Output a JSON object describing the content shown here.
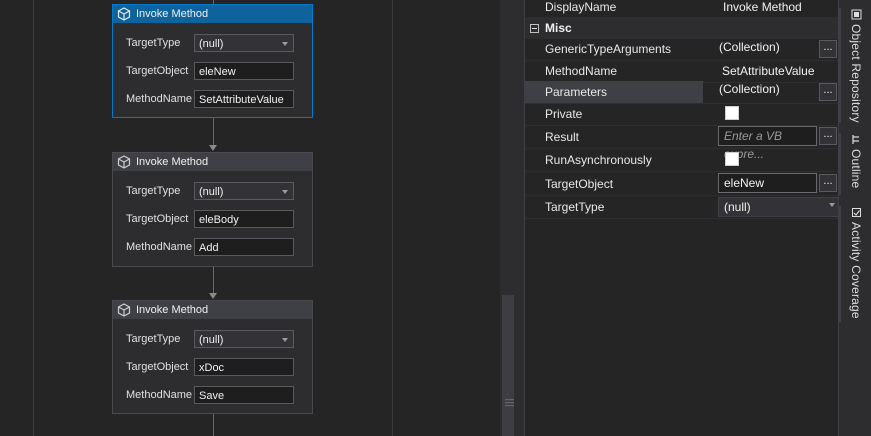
{
  "designer": {
    "activities": [
      {
        "title": "Invoke Method",
        "selected": true,
        "fields": [
          {
            "label": "TargetType",
            "value": "(null)",
            "kind": "select"
          },
          {
            "label": "TargetObject",
            "value": "eleNew",
            "kind": "text"
          },
          {
            "label": "MethodName",
            "value": "SetAttributeValue",
            "kind": "text"
          }
        ]
      },
      {
        "title": "Invoke Method",
        "selected": false,
        "fields": [
          {
            "label": "TargetType",
            "value": "(null)",
            "kind": "select"
          },
          {
            "label": "TargetObject",
            "value": "eleBody",
            "kind": "text"
          },
          {
            "label": "MethodName",
            "value": "Add",
            "kind": "text"
          }
        ]
      },
      {
        "title": "Invoke Method",
        "selected": false,
        "fields": [
          {
            "label": "TargetType",
            "value": "(null)",
            "kind": "select"
          },
          {
            "label": "TargetObject",
            "value": "xDoc",
            "kind": "text"
          },
          {
            "label": "MethodName",
            "value": "Save",
            "kind": "text"
          }
        ]
      }
    ]
  },
  "properties": {
    "top_row": {
      "name": "DisplayName",
      "value": "Invoke Method"
    },
    "category": "Misc",
    "rows": [
      {
        "name": "GenericTypeArguments",
        "value": "(Collection)",
        "kind": "collection"
      },
      {
        "name": "MethodName",
        "value": "SetAttributeValue",
        "kind": "text"
      },
      {
        "name": "Parameters",
        "value": "(Collection)",
        "kind": "collection"
      },
      {
        "name": "Private",
        "value": "",
        "kind": "checkbox"
      },
      {
        "name": "Result",
        "value": "Enter a VB expre...",
        "kind": "placeholder"
      },
      {
        "name": "RunAsynchronously",
        "value": "",
        "kind": "checkbox"
      },
      {
        "name": "TargetObject",
        "value": "eleNew",
        "kind": "boxed"
      },
      {
        "name": "TargetType",
        "value": "(null)",
        "kind": "select"
      }
    ],
    "ellipsis_label": "..."
  },
  "side_tabs": [
    {
      "label": "Object Repository",
      "icon": "object-repository-icon"
    },
    {
      "label": "Outline",
      "icon": "outline-icon"
    },
    {
      "label": "Activity Coverage",
      "icon": "activity-coverage-icon"
    }
  ],
  "colors": {
    "accent": "#007acc",
    "selected_header": "#0e639c",
    "background": "#252526"
  }
}
